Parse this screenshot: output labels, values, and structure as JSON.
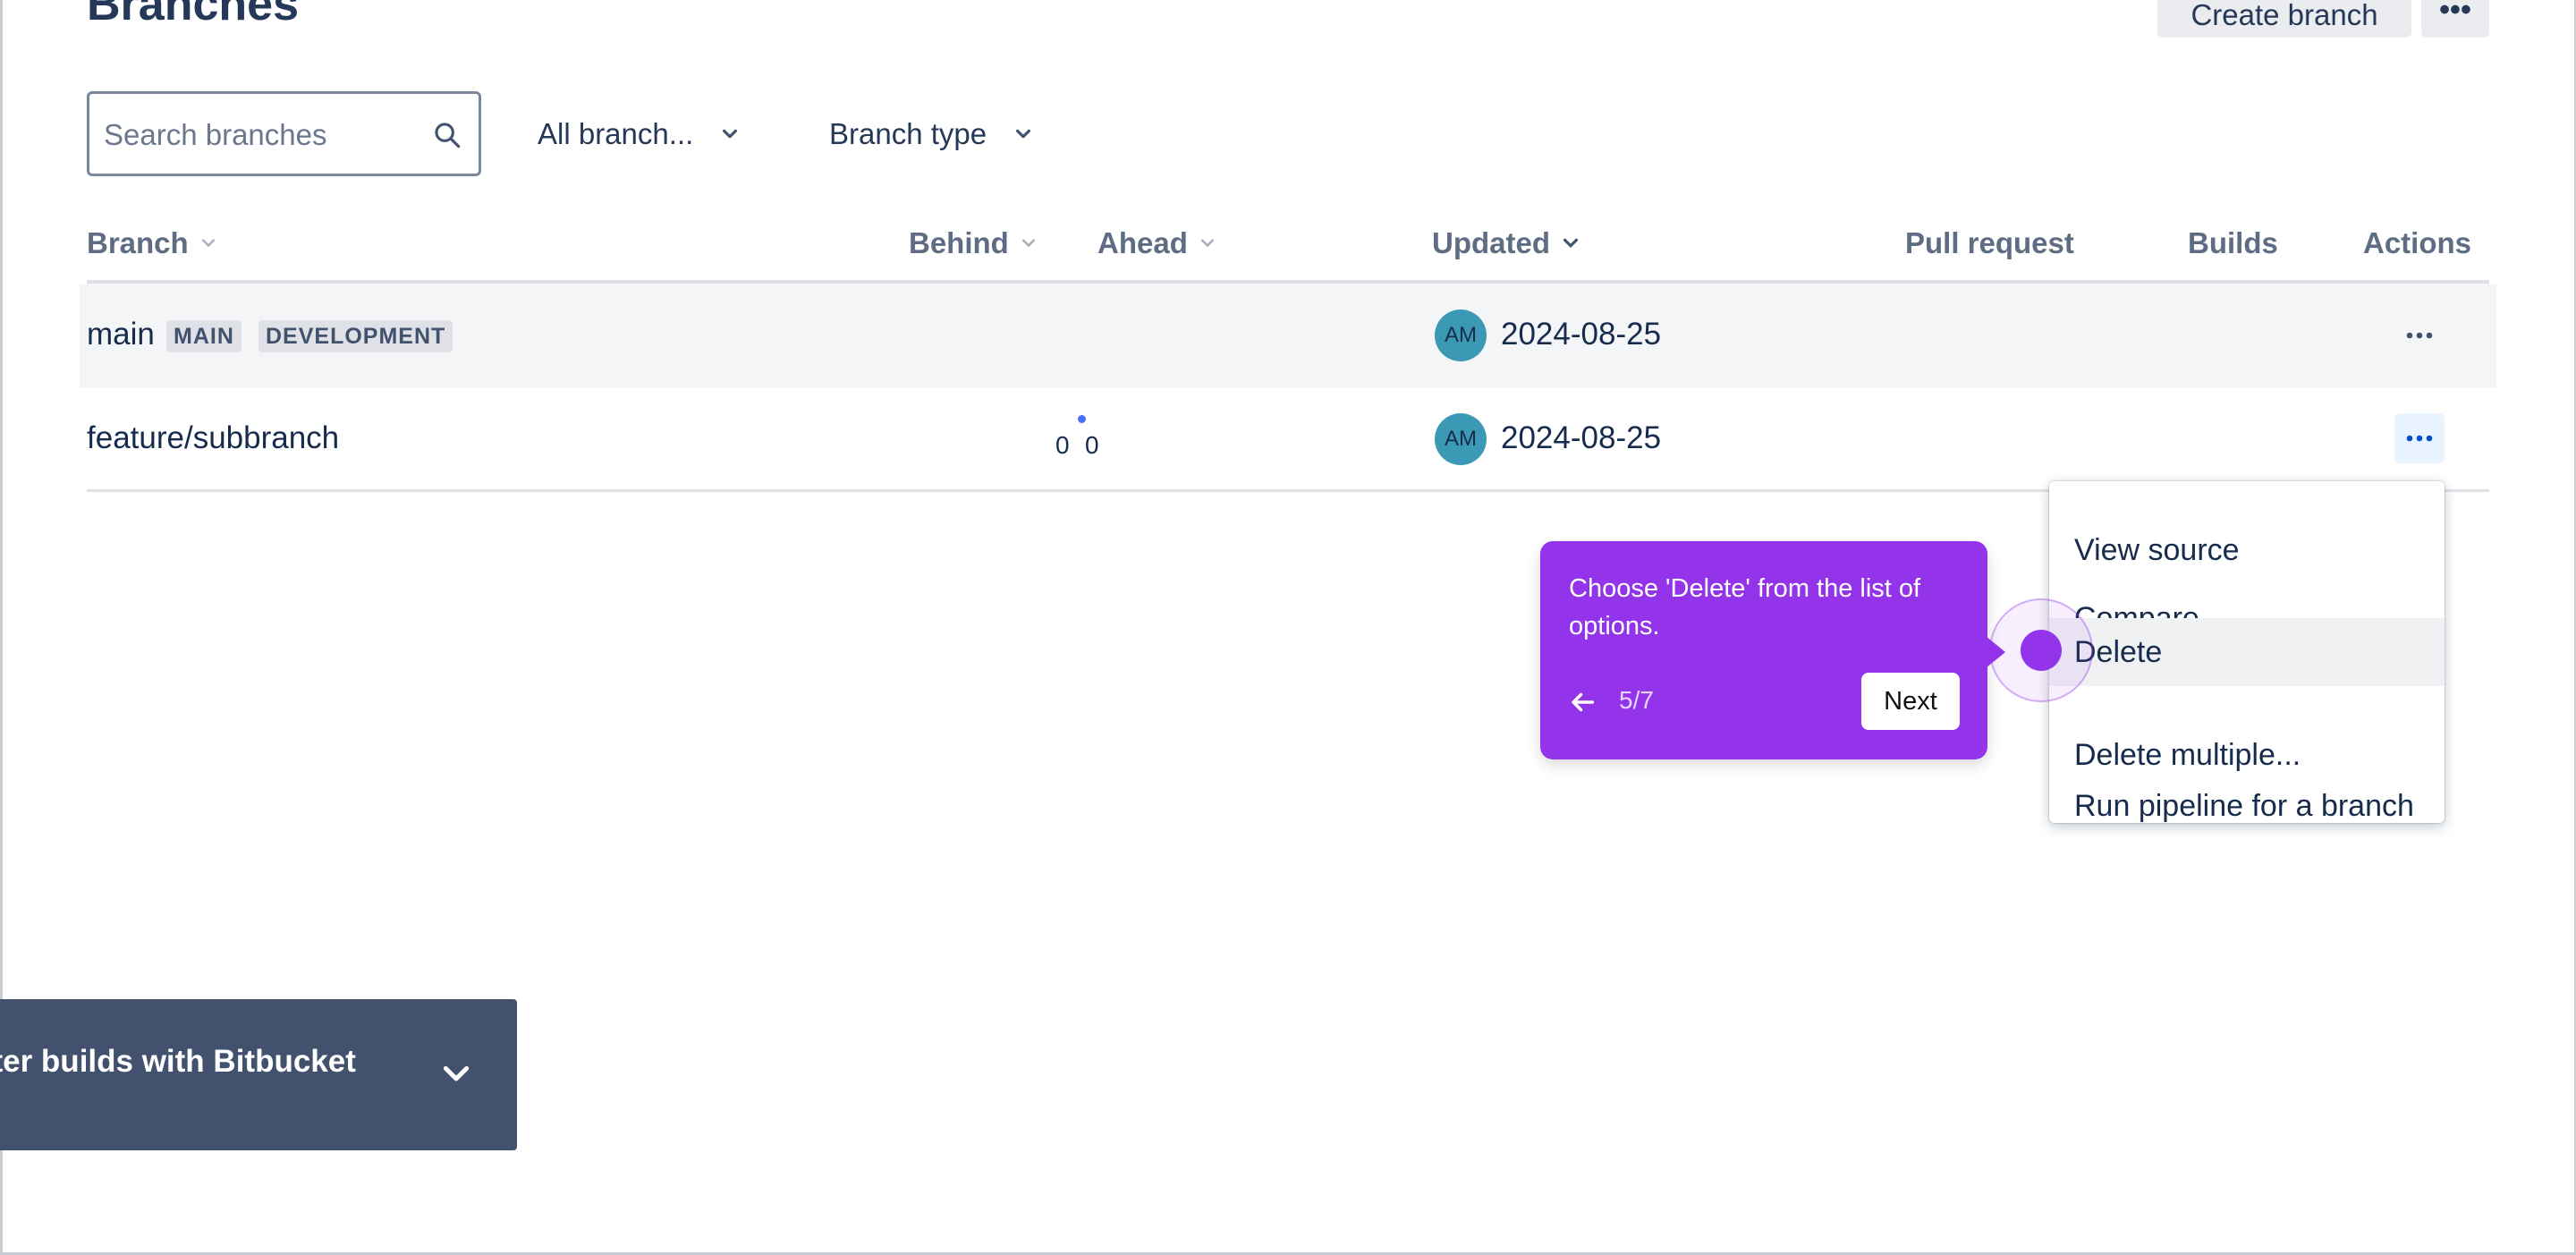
{
  "page": {
    "title": "Branches"
  },
  "header_actions": {
    "create_branch": "Create branch",
    "more": "•••"
  },
  "filters": {
    "search_placeholder": "Search branches",
    "all_branches": "All branch...",
    "branch_type": "Branch type"
  },
  "table": {
    "columns": {
      "branch": "Branch",
      "behind": "Behind",
      "ahead": "Ahead",
      "updated": "Updated",
      "pull_request": "Pull request",
      "builds": "Builds",
      "actions": "Actions"
    },
    "rows": [
      {
        "name": "main",
        "badges": [
          "MAIN",
          "DEVELOPMENT"
        ],
        "behind": "",
        "ahead": "",
        "avatar": "AM",
        "updated": "2024-08-25"
      },
      {
        "name": "feature/subbranch",
        "badges": [],
        "behind": "0",
        "ahead": "0",
        "avatar": "AM",
        "updated": "2024-08-25"
      }
    ]
  },
  "actions_menu": {
    "items": [
      "View source",
      "Compare",
      "Delete",
      "Delete multiple...",
      "Run pipeline for a branch"
    ],
    "highlighted": "Delete"
  },
  "tooltip": {
    "text": "Choose 'Delete' from the list of options.",
    "step": "5/7",
    "next": "Next"
  },
  "banner": {
    "text": "ster builds with Bitbucket"
  },
  "colors": {
    "accent": "#9333ea",
    "link": "#0052cc",
    "banner": "#42526e",
    "avatar": "#3c99b6"
  }
}
